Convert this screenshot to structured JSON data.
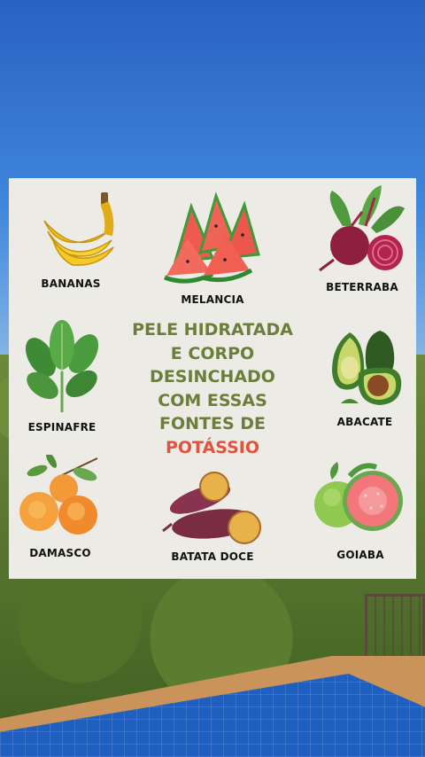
{
  "headline": {
    "lines": [
      "PELE HIDRATADA",
      "E CORPO",
      "DESINCHADO",
      "COM ESSAS",
      "FONTES DE"
    ],
    "highlight": "POTÁSSIO"
  },
  "foods": [
    {
      "name": "BANANAS",
      "icon": "banana-icon"
    },
    {
      "name": "MELANCIA",
      "icon": "watermelon-icon"
    },
    {
      "name": "BETERRABA",
      "icon": "beetroot-icon"
    },
    {
      "name": "ESPINAFRE",
      "icon": "spinach-icon"
    },
    {
      "name": "ABACATE",
      "icon": "avocado-icon"
    },
    {
      "name": "DAMASCO",
      "icon": "apricot-icon"
    },
    {
      "name": "BATATA DOCE",
      "icon": "sweet-potato-icon"
    },
    {
      "name": "GOIABA",
      "icon": "guava-icon"
    }
  ],
  "colors": {
    "headline": "#6b7e3a",
    "accent": "#e2533e",
    "card": "#ecebe5"
  }
}
